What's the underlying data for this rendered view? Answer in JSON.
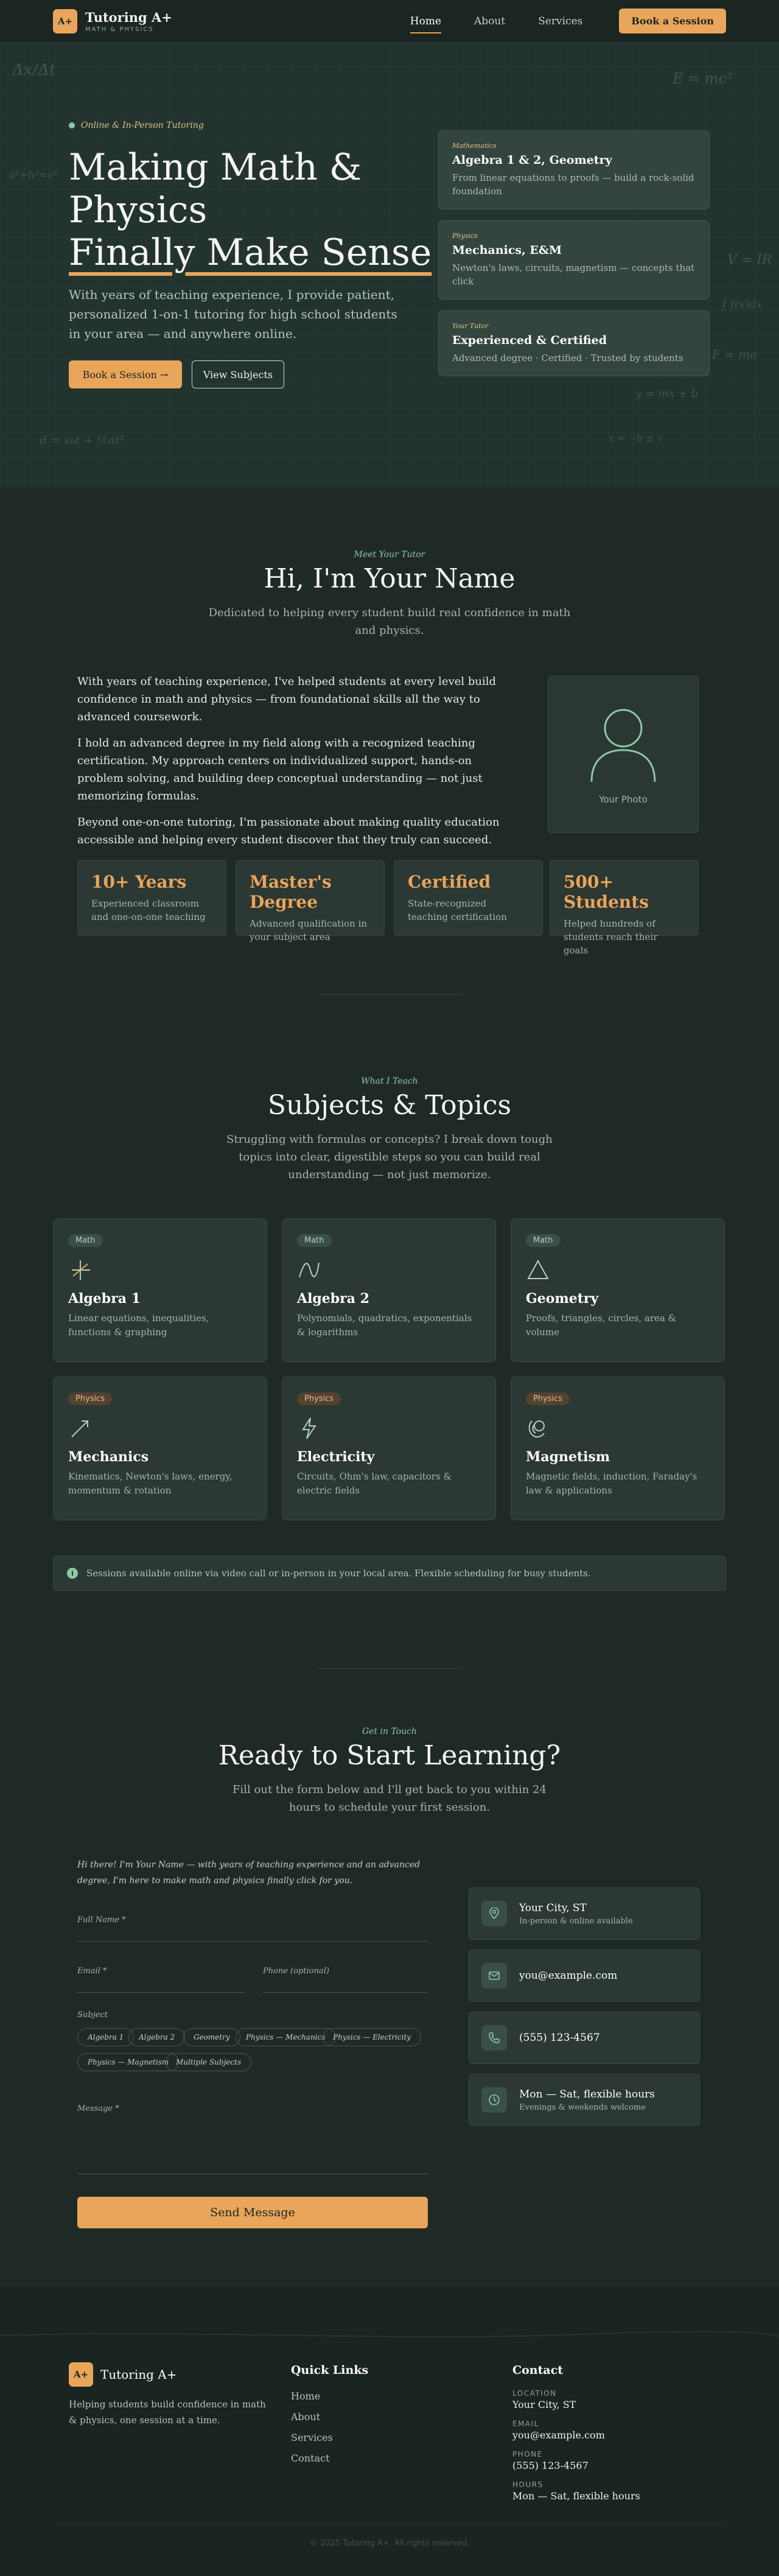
{
  "nav": {
    "logo": "A+",
    "brand": "Tutoring A+",
    "subtitle": "MATH & PHYSICS",
    "links": [
      "Home",
      "About",
      "Services"
    ],
    "cta": "Book a Session"
  },
  "hero": {
    "tag": "Online & In-Person Tutoring",
    "title_l1": "Making Math &",
    "title_l2": "Physics",
    "title_l3": "Finally Make Sense",
    "paragraph": "With years of teaching experience, I provide patient, personalized 1-on-1 tutoring for high school students in your area — and anywhere online.",
    "btn_primary": "Book a Session →",
    "btn_secondary": "View Subjects",
    "chalk": [
      "Δx/Δt",
      "E = mc²",
      "a²+b²=c²",
      "V = IR",
      "F = ma",
      "y = mx + b",
      "∫ f(x)dx",
      "d = v₀t + ½at²",
      "x = −b ± √"
    ],
    "cards": [
      {
        "tag": "Mathematics",
        "title": "Algebra 1 & 2, Geometry",
        "desc": "From linear equations to proofs — build a rock-solid foundation"
      },
      {
        "tag": "Physics",
        "title": "Mechanics, E&M",
        "desc": "Newton's laws, circuits, magnetism — concepts that click"
      },
      {
        "tag": "Your Tutor",
        "title": "Experienced & Certified",
        "desc": "Advanced degree · Certified · Trusted by students"
      }
    ]
  },
  "about": {
    "tag": "Meet Your Tutor",
    "title": "Hi, I'm Your Name",
    "subtitle": "Dedicated to helping every student build real confidence in math and physics.",
    "paragraphs": [
      "With years of teaching experience, I've helped students at every level build confidence in math and physics — from foundational skills all the way to advanced coursework.",
      "I hold an advanced degree in my field along with a recognized teaching certification. My approach centers on individualized support, hands-on problem solving, and building deep conceptual understanding — not just memorizing formulas.",
      "Beyond one-on-one tutoring, I'm passionate about making quality education accessible and helping every student discover that they truly can succeed."
    ],
    "photo_label": "Your Photo",
    "stats": [
      {
        "num": "10+ Years",
        "label": "Experienced classroom and one-on-one teaching"
      },
      {
        "num": "Master's Degree",
        "label": "Advanced qualification in your subject area"
      },
      {
        "num": "Certified",
        "label": "State-recognized teaching certification"
      },
      {
        "num": "500+ Students",
        "label": "Helped hundreds of students reach their goals"
      }
    ]
  },
  "subjects": {
    "tag": "What I Teach",
    "title": "Subjects & Topics",
    "subtitle": "Struggling with formulas or concepts? I break down tough topics into clear, digestible steps so you can build real understanding — not just memorize.",
    "cards": [
      {
        "cat": "Math",
        "name": "Algebra 1",
        "desc": "Linear equations, inequalities, functions & graphing",
        "icon": "axes-icon"
      },
      {
        "cat": "Math",
        "name": "Algebra 2",
        "desc": "Polynomials, quadratics, exponentials & logarithms",
        "icon": "curve-icon"
      },
      {
        "cat": "Math",
        "name": "Geometry",
        "desc": "Proofs, triangles, circles, area & volume",
        "icon": "triangle-icon"
      },
      {
        "cat": "Physics",
        "name": "Mechanics",
        "desc": "Kinematics, Newton's laws, energy, momentum & rotation",
        "icon": "vector-icon"
      },
      {
        "cat": "Physics",
        "name": "Electricity",
        "desc": "Circuits, Ohm's law, capacitors & electric fields",
        "icon": "bolt-icon"
      },
      {
        "cat": "Physics",
        "name": "Magnetism",
        "desc": "Magnetic fields, induction, Faraday's law & applications",
        "icon": "magnet-icon"
      }
    ],
    "notice": "Sessions available online via video call or in-person in your local area. Flexible scheduling for busy students."
  },
  "contact": {
    "tag": "Get in Touch",
    "title": "Ready to Start Learning?",
    "subtitle": "Fill out the form below and I'll get back to you within 24 hours to schedule your first session.",
    "intro": "Hi there! I'm Your Name — with years of teaching experience and an advanced degree, I'm here to make math and physics finally click for you.",
    "fields": {
      "name": "Full Name *",
      "email": "Email *",
      "phone": "Phone (optional)",
      "subject": "Subject",
      "message": "Message *"
    },
    "chips": [
      "Algebra 1",
      "Algebra 2",
      "Geometry",
      "Physics — Mechanics",
      "Physics — Electricity",
      "Physics — Magnetism",
      "Multiple Subjects"
    ],
    "send": "Send Message",
    "info": [
      {
        "title": "Your City, ST",
        "sub": "In-person & online available",
        "icon": "location-icon"
      },
      {
        "title": "you@example.com",
        "sub": "",
        "icon": "mail-icon"
      },
      {
        "title": "(555) 123-4567",
        "sub": "",
        "icon": "phone-icon"
      },
      {
        "title": "Mon — Sat, flexible hours",
        "sub": "Evenings & weekends welcome",
        "icon": "clock-icon"
      }
    ]
  },
  "footer": {
    "logo": "A+",
    "brand": "Tutoring A+",
    "tagline": "Helping students build confidence in math & physics, one session at a time.",
    "quick_title": "Quick Links",
    "links": [
      "Home",
      "About",
      "Services",
      "Contact"
    ],
    "contact_title": "Contact",
    "location_label": "LOCATION",
    "location": "Your City, ST",
    "email_label": "EMAIL",
    "email": "you@example.com",
    "phone_label": "PHONE",
    "phone": "(555) 123-4567",
    "hours_label": "HOURS",
    "hours": "Mon — Sat, flexible hours",
    "copyright": "© 2025 Tutoring A+. All rights reserved."
  },
  "colors": {
    "accent": "#e9a55a",
    "background": "#1f2a27",
    "green": "#8fc7a6"
  }
}
